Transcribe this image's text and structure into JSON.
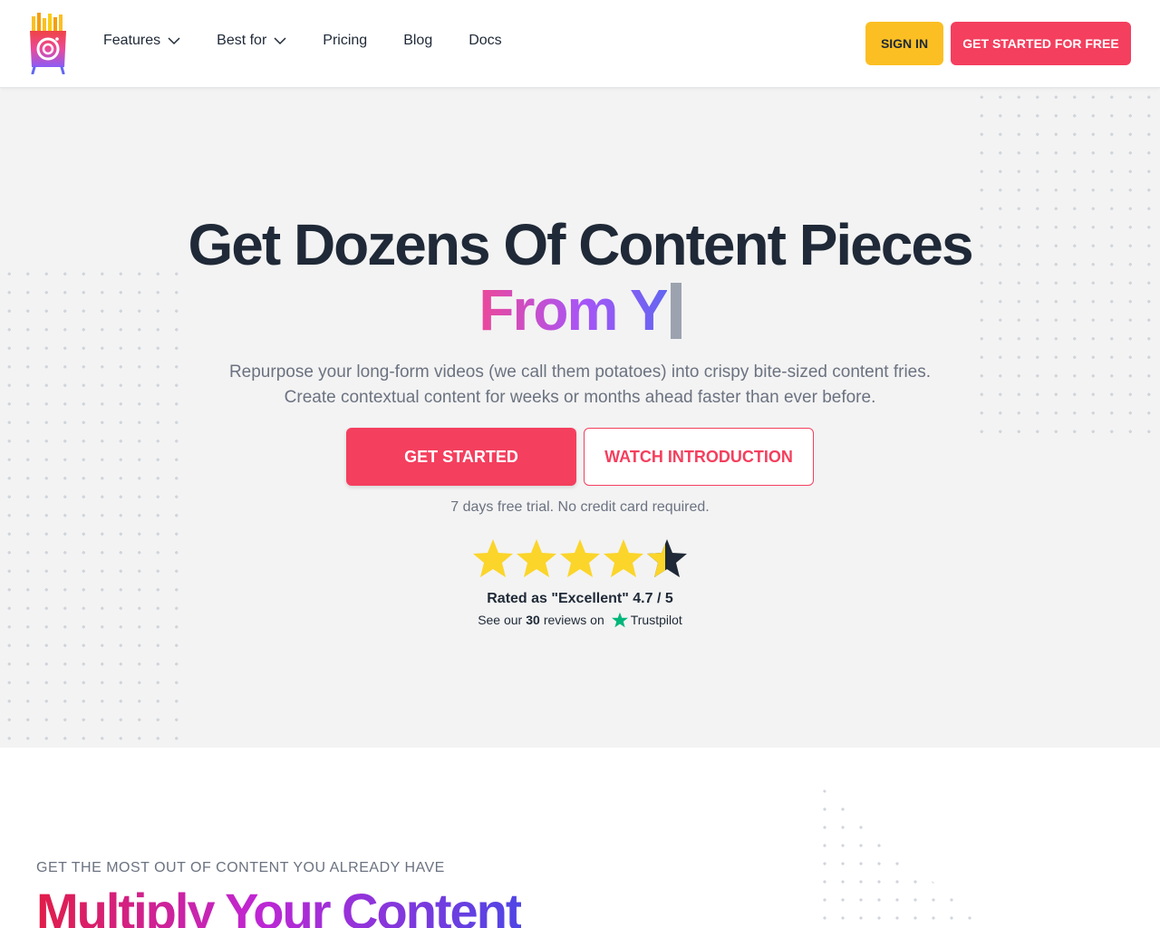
{
  "header": {
    "logo_icon": "fries-box-camera-logo-icon",
    "nav": [
      {
        "label": "Features",
        "has_dropdown": true
      },
      {
        "label": "Best for",
        "has_dropdown": true
      },
      {
        "label": "Pricing",
        "has_dropdown": false
      },
      {
        "label": "Blog",
        "has_dropdown": false
      },
      {
        "label": "Docs",
        "has_dropdown": false
      }
    ],
    "sign_in_label": "SIGN IN",
    "get_started_free_label": "GET STARTED FOR FREE"
  },
  "hero": {
    "title_line1": "Get Dozens Of Content Pieces",
    "title_line2": "From Y",
    "subtitle": "Repurpose your long-form videos (we call them potatoes) into crispy bite-sized content fries. Create contextual content for weeks or months ahead faster than ever before.",
    "primary_cta": "GET STARTED",
    "secondary_cta": "WATCH INTRODUCTION",
    "trial_note": "7 days free trial. No credit card required.",
    "rating": {
      "value": 4.7,
      "max": 5,
      "text": "Rated as \"Excellent\" 4.7 / 5",
      "reviews_prefix": "See our",
      "reviews_count": "30",
      "reviews_suffix": "reviews on",
      "platform": "Trustpilot",
      "platform_icon": "trustpilot-star-icon"
    }
  },
  "section2": {
    "eyebrow": "GET THE MOST OUT OF CONTENT YOU ALREADY HAVE",
    "title": "Multiply Your Content"
  },
  "colors": {
    "accent": "#f43f5e",
    "signin": "#fbbf24",
    "star": "#fbd52a",
    "star_dark": "#1f2937",
    "trustpilot": "#00b67a"
  }
}
